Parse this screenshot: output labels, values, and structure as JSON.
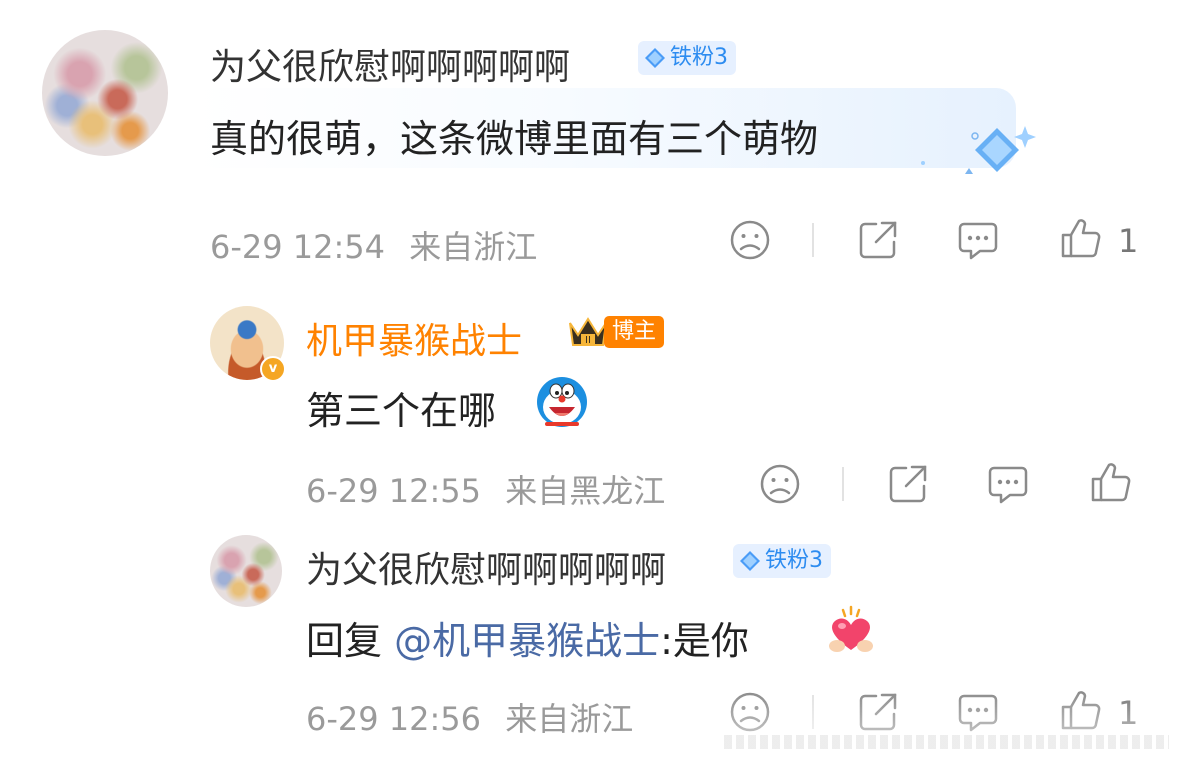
{
  "comments": [
    {
      "username": "为父很欣慰啊啊啊啊啊",
      "fan_badge": "铁粉3",
      "content": "真的很萌，这条微博里面有三个萌物",
      "time": "6-29 12:54",
      "location": "来自浙江",
      "like_count": "1"
    },
    {
      "username": "机甲暴猴战士",
      "role_badge": "博主",
      "content": "第三个在哪",
      "time": "6-29 12:55",
      "location": "来自黑龙江",
      "like_count": ""
    },
    {
      "username": "为父很欣慰啊啊啊啊啊",
      "fan_badge": "铁粉3",
      "reply_prefix": "回复 ",
      "mention": "@机甲暴猴战士",
      "reply_text": ":是你",
      "time": "6-29 12:56",
      "location": "来自浙江",
      "like_count": "1"
    }
  ],
  "icons": {
    "dislike": "frown-face-icon",
    "share": "share-icon",
    "comment": "comment-icon",
    "like": "thumbs-up-icon",
    "badge_gem": "diamond-icon",
    "crown": "crown-icon",
    "verified": "verified-v-icon"
  },
  "colors": {
    "blogger_name": "#ff8200",
    "fan_badge_text": "#2d8cf0",
    "mention": "#4a6aa5",
    "meta_text": "#9a9a9a"
  }
}
